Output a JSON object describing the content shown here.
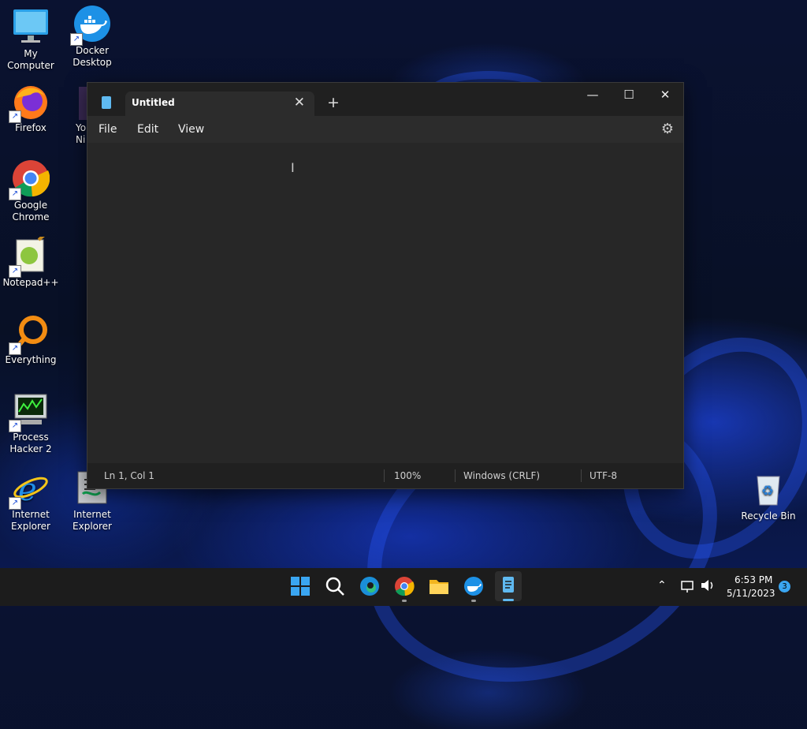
{
  "desktop": {
    "icons": [
      {
        "label": "My Computer"
      },
      {
        "label": "Docker\nDesktop"
      },
      {
        "label": "Firefox"
      },
      {
        "label": "Yo\nNi"
      },
      {
        "label": "Google\nChrome"
      },
      {
        "label": "Notepad++"
      },
      {
        "label": "Everything"
      },
      {
        "label": "Process\nHacker 2"
      },
      {
        "label": "Internet\nExplorer"
      },
      {
        "label": "Internet\nExplorer"
      },
      {
        "label": "Recycle Bin"
      }
    ]
  },
  "notepad": {
    "tab_title": "Untitled",
    "menu": {
      "file": "File",
      "edit": "Edit",
      "view": "View"
    },
    "status": {
      "position": "Ln 1, Col 1",
      "zoom": "100%",
      "line_ending": "Windows (CRLF)",
      "encoding": "UTF-8"
    }
  },
  "taskbar": {
    "time": "6:53 PM",
    "date": "5/11/2023",
    "notifications": "3"
  },
  "colors": {
    "accent": "#0078d4",
    "window_bg": "#272727",
    "taskbar_bg": "#1c1c1c"
  }
}
